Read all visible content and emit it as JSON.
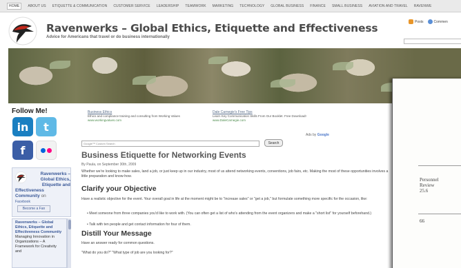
{
  "nav": {
    "items": [
      "Home",
      "About Us",
      "Etiquette & Communication",
      "Customer Service",
      "Leadership",
      "Teamwork",
      "Marketing",
      "Technology",
      "Global Business",
      "Finance",
      "Small Business",
      "Aviation and Travel",
      "Ravenwe"
    ]
  },
  "site": {
    "title": "Ravenwerks – Global Ethics, Etiquette and Effectiveness",
    "tagline": "Advice for Americans that travel or do business internationally"
  },
  "feeds": {
    "posts": "Posts",
    "comments": "Commen"
  },
  "sidebar": {
    "follow_label": "Follow Me!",
    "social": [
      {
        "name": "linkedin-icon",
        "glyph": "in"
      },
      {
        "name": "twitter-icon",
        "glyph": "t"
      },
      {
        "name": "facebook-icon",
        "glyph": "f"
      },
      {
        "name": "flickr-icon",
        "glyph": ""
      }
    ],
    "fb_box": {
      "name_line1": "Ravenwerks –",
      "name_line2": "Global Ethics,",
      "name_line3": "Etiquette and",
      "name_line4": "Effectiveness",
      "name_line5": "Community",
      "name_on": "on",
      "platform": "Facebook",
      "button": "Become a Fan"
    },
    "fb_feed": {
      "title": "Ravenwerks – Global Ethics, Etiquette and Effectiveness Community",
      "post": "Managing Innovation in Organizations – A Framework for Creativity and"
    }
  },
  "ads": [
    {
      "title": "Business Ethics",
      "desc": "Ethics and compliance training and consulting from Working Values",
      "url": "www.workingvalues.com"
    },
    {
      "title": "Dale Carnegie's Free Tips",
      "desc": "Learn Key Communication Skills From Our Booklet. Free Download!",
      "url": "www.DaleCarnegie.com"
    }
  ],
  "ads_by": {
    "label": "Ads by",
    "brand": "Google"
  },
  "search": {
    "placeholder": "Google™ Custom Search",
    "button": "Search"
  },
  "post": {
    "title": "Business Etiquette for Networking Events",
    "byline": "By Paula, on September 30th, 2009",
    "intro": "Whether we're looking to make sales, land a job, or just keep up in our industry, most of us attend networking events, conventions, job fairs, etc. Making the most of these opportunities involves a little preparation and know-how.",
    "h_clarify": "Clarify your Objective",
    "clarify_text": "Have a realistic objective for the event. Your overall goal in life at the moment might be to \"increase sales\" or \"get a job,\" but formulate something more specific for the occasion, like:",
    "bullet1": "Meet someone from three companies you'd like to work with. (You can often get a list of who's attending from the event organizers and make a \"short list\" for yourself beforehand.)",
    "bullet2": "Talk with ten people and get contact information for four of them.",
    "h_distill": "Distill Your Message",
    "distill_text": "Have an answer ready for common questions.",
    "question": "\"What do you do?\" \"What type of job are you looking for?\""
  },
  "overlay": {
    "line1": "Personnel",
    "line2": "Review",
    "line3": "25.6",
    "page": "66"
  }
}
